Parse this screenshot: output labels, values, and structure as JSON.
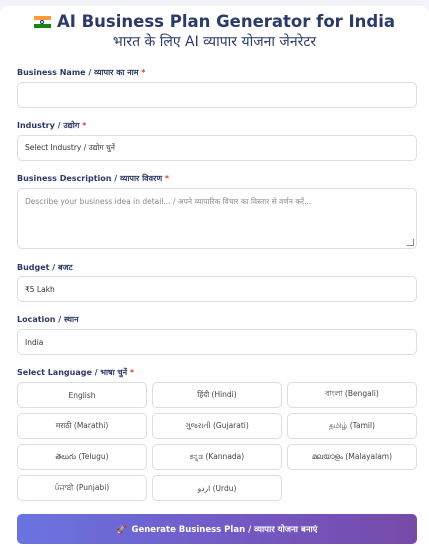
{
  "header": {
    "title": "AI Business Plan Generator for India",
    "subtitle": "भारत के लिए AI व्यापार योजना जेनरेटर",
    "flag_icon": "india-flag-icon"
  },
  "form": {
    "business_name": {
      "label": "Business Name / व्यापार का नाम",
      "required": "*",
      "value": ""
    },
    "industry": {
      "label": "Industry / उद्योग",
      "required": "*",
      "value": "Select Industry / उद्योग चुनें"
    },
    "description": {
      "label": "Business Description / व्यापार विवरण",
      "required": "*",
      "placeholder": "Describe your business idea in detail... / अपने व्यापारिक विचार का विस्तार से वर्णन करें..."
    },
    "budget": {
      "label": "Budget / बजट",
      "value": "₹5 Lakh"
    },
    "location": {
      "label": "Location / स्थान",
      "value": "India"
    },
    "language": {
      "label": "Select Language / भाषा चुनें",
      "required": "*",
      "options": [
        "English",
        "हिंदी (Hindi)",
        "বাংলা (Bengali)",
        "मराठी (Marathi)",
        "ગુજરાતી (Gujarati)",
        "தமிழ் (Tamil)",
        "తెలుగు (Telugu)",
        "ಕನ್ನಡ (Kannada)",
        "മലയാളം (Malayalam)",
        "ਪੰਜਾਬੀ (Punjabi)",
        "اردو (Urdu)"
      ]
    },
    "generate_button": {
      "label": "Generate Business Plan / व्यापार योजना बनाएं",
      "icon": "rocket-icon"
    }
  },
  "colors": {
    "title": "#2b3a67",
    "required": "#e53935",
    "button_start": "#6a74e0",
    "button_end": "#774aa8"
  }
}
